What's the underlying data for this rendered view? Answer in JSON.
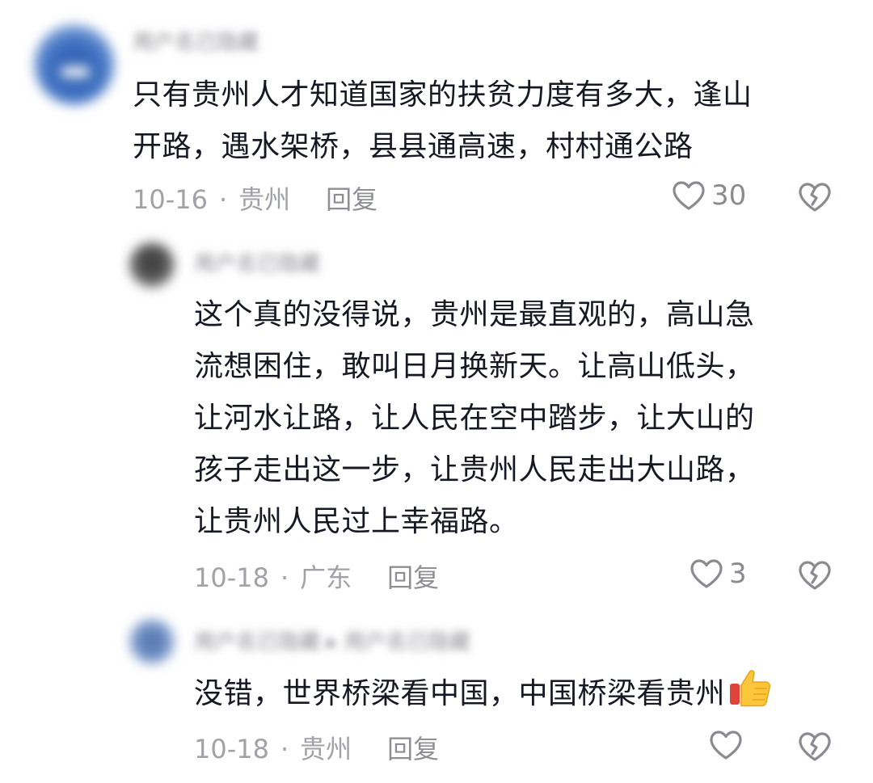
{
  "comments": [
    {
      "username": "用户名已隐藏",
      "text": "只有贵州人才知道国家的扶贫力度有多大，逢山\n开路，遇水架桥，县县通高速，村村通公路",
      "date": "10-16",
      "location": "贵州",
      "reply_label": "回复",
      "likes": "30"
    },
    {
      "username": "用户名已隐藏",
      "text": "这个真的没得说，贵州是最直观的，高山急\n流想困住，敢叫日月换新天。让高山低头，\n让河水让路，让人民在空中踏步，让大山的\n孩子走出这一步，让贵州人民走出大山路，\n让贵州人民过上幸福路。",
      "date": "10-18",
      "location": "广东",
      "reply_label": "回复",
      "likes": "3"
    },
    {
      "username": "用户名已隐藏 ▸ 用户名已隐藏",
      "text": "没错，世界桥梁看中国，中国桥梁看贵州",
      "date": "10-18",
      "location": "贵州",
      "reply_label": "回复",
      "likes": ""
    }
  ],
  "icons": {
    "like": "heart-outline-icon",
    "dislike": "broken-heart-icon",
    "emoji": "thumbs-up-emoji-icon"
  },
  "colors": {
    "text": "#161823",
    "meta": "#a1a2a7",
    "icon": "#8a8b91"
  }
}
